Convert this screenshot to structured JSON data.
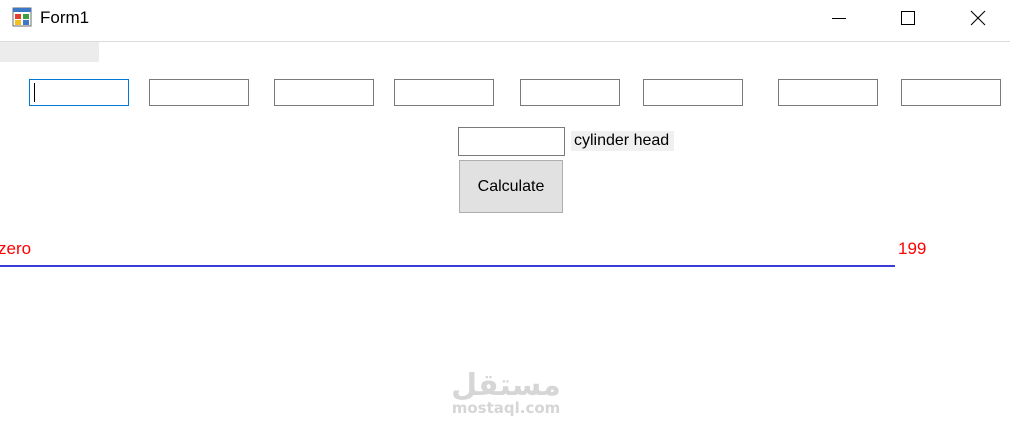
{
  "window": {
    "title": "Form1",
    "icons": {
      "app": "winforms-app-icon",
      "minimize": "minimize-icon",
      "maximize": "maximize-icon",
      "close": "close-icon"
    }
  },
  "inputs": {
    "row": [
      {
        "value": ""
      },
      {
        "value": ""
      },
      {
        "value": ""
      },
      {
        "value": ""
      },
      {
        "value": ""
      },
      {
        "value": ""
      },
      {
        "value": ""
      },
      {
        "value": ""
      }
    ],
    "cylinder_head": {
      "value": "",
      "label": "cylinder head"
    }
  },
  "actions": {
    "calculate_label": "Calculate"
  },
  "range": {
    "min_label": "zero",
    "max_label": "199",
    "line_color": "#3b3bd8",
    "label_color": "#ff0000"
  },
  "watermark": {
    "arabic": "مستقل",
    "latin": "mostaql.com"
  }
}
